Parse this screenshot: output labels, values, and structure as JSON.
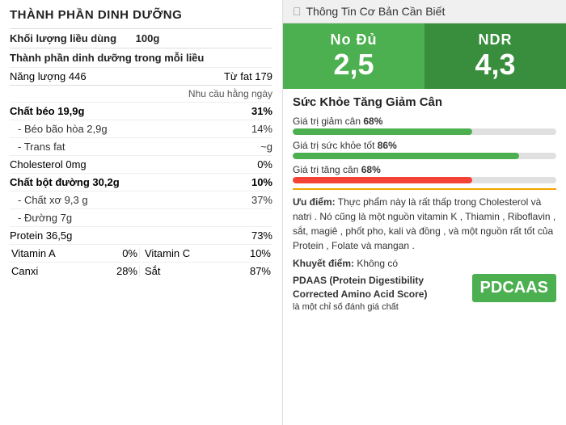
{
  "left": {
    "title": "THÀNH PHẦN DINH DƯỠNG",
    "serving_label": "Khối lượng liều dùng",
    "serving_value": "100g",
    "section_label": "Thành phần dinh dưỡng trong mỗi liều",
    "energy_label": "Năng lượng 446",
    "energy_fat": "Từ fat 179",
    "nhu_cau": "Nhu cầu hằng ngày",
    "rows": [
      {
        "label": "Chất béo 19,9g",
        "value": "31%",
        "bold": true
      },
      {
        "label": "- Béo bão hòa 2,9g",
        "value": "14%",
        "sub": true
      },
      {
        "label": "- Trans fat",
        "value": "~g",
        "sub": true
      },
      {
        "label": "Cholesterol 0mg",
        "value": "0%",
        "bold": false
      },
      {
        "label": "Chất bột đường 30,2g",
        "value": "10%",
        "bold": true
      },
      {
        "label": "- Chất xơ 9,3 g",
        "value": "37%",
        "sub": true
      },
      {
        "label": "- Đường 7g",
        "value": "",
        "sub": true
      },
      {
        "label": "Protein 36,5g",
        "value": "73%",
        "bold": false
      }
    ],
    "vitamins": [
      {
        "left_label": "Vitamin A",
        "left_value": "0%",
        "right_label": "Vitamin C",
        "right_value": "10%"
      },
      {
        "left_label": "Canxi",
        "left_value": "28%",
        "right_label": "Sắt",
        "right_value": "87%"
      }
    ]
  },
  "right": {
    "header_title": "Thông Tin Cơ Bản Cần Biết",
    "score1_label": "No Đủ",
    "score1_value": "2,5",
    "score2_label": "NDR",
    "score2_value": "4,3",
    "health_title": "Sức Khỏe Tăng Giảm Cân",
    "progress_items": [
      {
        "label": "Giá trị giảm cân",
        "percent_text": "68%",
        "percent": 68,
        "color": "#4caf50"
      },
      {
        "label": "Giá trị sức khỏe tốt",
        "percent_text": "86%",
        "percent": 86,
        "color": "#4caf50"
      },
      {
        "label": "Giá trị tăng cân",
        "percent_text": "68%",
        "percent": 68,
        "color": "#f44336"
      }
    ],
    "uu_diem_label": "Ưu điểm:",
    "uu_diem_text": "Thực phẩm này là rất thấp trong Cholesterol và natri . Nó cũng là một nguồn vitamin K , Thiamin , Riboflavin , sắt, magiê , phốt pho, kali và đồng , và một nguồn rất tốt của Protein , Folate và mangan .",
    "khuyet_diem_label": "Khuyết điểm:",
    "khuyet_diem_text": "Không có",
    "pdcaas_title": "PDAAS (Protein Digestibility Corrected Amino Acid Score)",
    "pdcaas_desc": "là một chỉ số đánh giá chất",
    "pdcaas_badge": "PDCAAS"
  }
}
